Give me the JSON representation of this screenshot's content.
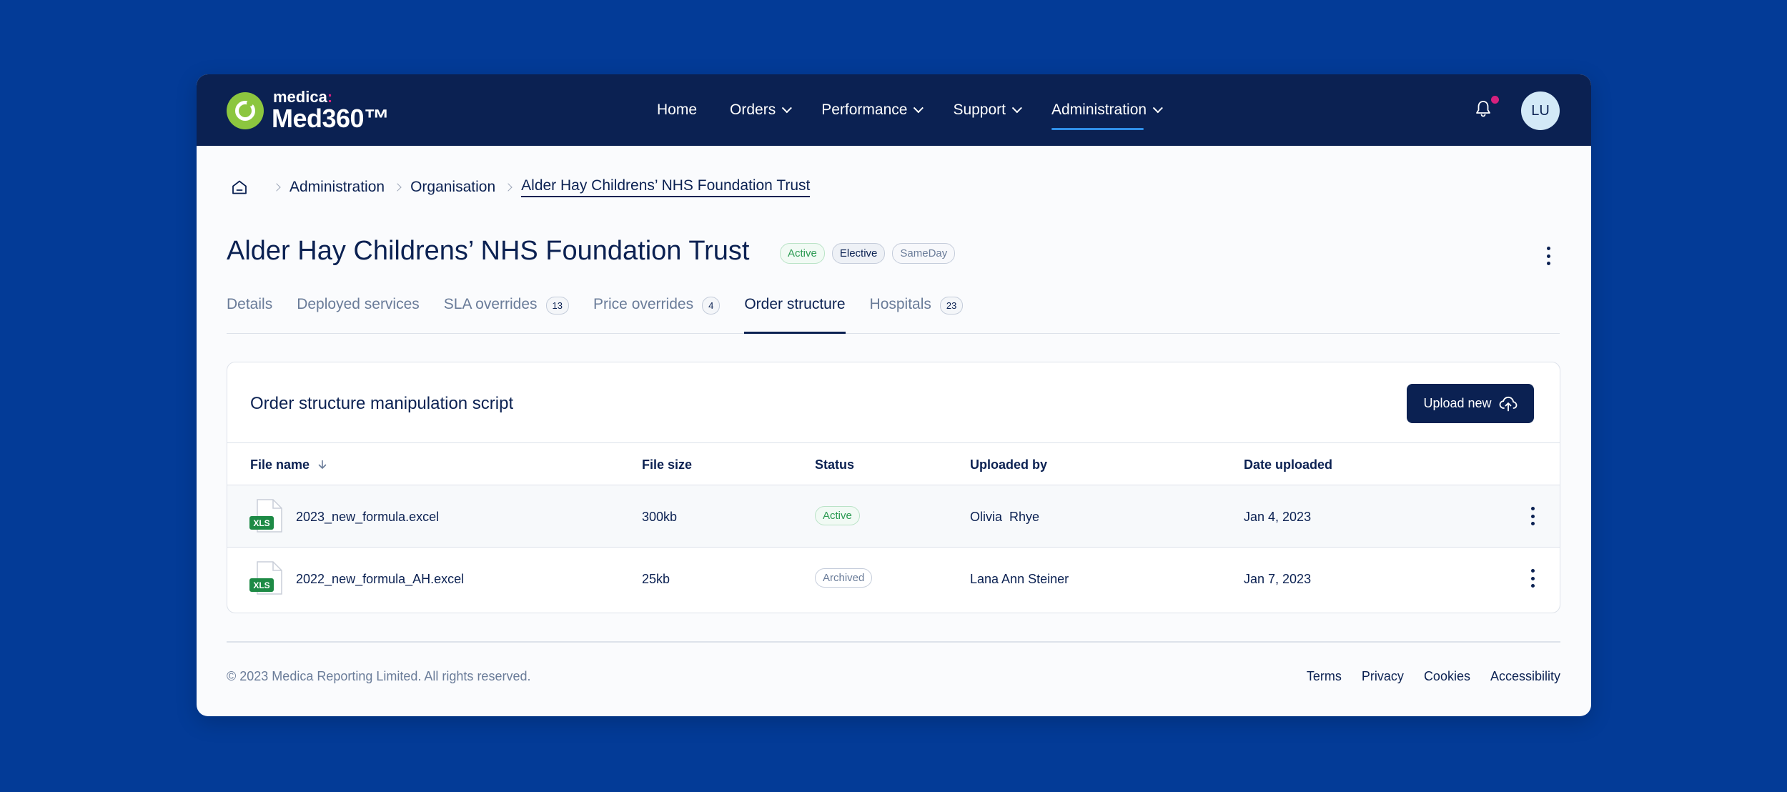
{
  "logo": {
    "top": "medica",
    "colon": ":",
    "bottom": "Med360™"
  },
  "nav": {
    "items": [
      {
        "label": "Home"
      },
      {
        "label": "Orders"
      },
      {
        "label": "Performance"
      },
      {
        "label": "Support"
      },
      {
        "label": "Administration"
      }
    ],
    "avatar_initials": "LU"
  },
  "breadcrumb": {
    "items": [
      "Administration",
      "Organisation"
    ],
    "current": "Alder Hay Childrens’ NHS Foundation Trust"
  },
  "page": {
    "title": "Alder Hay Childrens’ NHS Foundation Trust",
    "badges": [
      "Active",
      "Elective",
      "SameDay"
    ]
  },
  "tabs": [
    {
      "label": "Details"
    },
    {
      "label": "Deployed services"
    },
    {
      "label": "SLA overrides",
      "count": "13"
    },
    {
      "label": "Price overrides",
      "count": "4"
    },
    {
      "label": "Order structure"
    },
    {
      "label": "Hospitals",
      "count": "23"
    }
  ],
  "card": {
    "title": "Order structure manipulation script",
    "upload_label": "Upload new",
    "columns": [
      "File name",
      "File size",
      "Status",
      "Uploaded by",
      "Date uploaded"
    ],
    "file_icon_label": "XLS",
    "rows": [
      {
        "file_name": "2023_new_formula.excel",
        "file_size": "300kb",
        "status": "Active",
        "uploaded_by": "Olivia  Rhye",
        "date": "Jan 4, 2023"
      },
      {
        "file_name": "2022_new_formula_AH.excel",
        "file_size": "25kb",
        "status": "Archived",
        "uploaded_by": "Lana Ann Steiner",
        "date": "Jan 7, 2023"
      }
    ]
  },
  "footer": {
    "copyright": "© 2023 Medica Reporting Limited. All rights reserved.",
    "links": [
      "Terms",
      "Privacy",
      "Cookies",
      "Accessibility"
    ]
  },
  "colors": {
    "background": "#033B97",
    "navbar": "#0B2152",
    "brand_green": "#8CC63F",
    "accent_pink": "#D6217E",
    "active_underline": "#2F8FE8",
    "status_active": "#2B9A52"
  }
}
